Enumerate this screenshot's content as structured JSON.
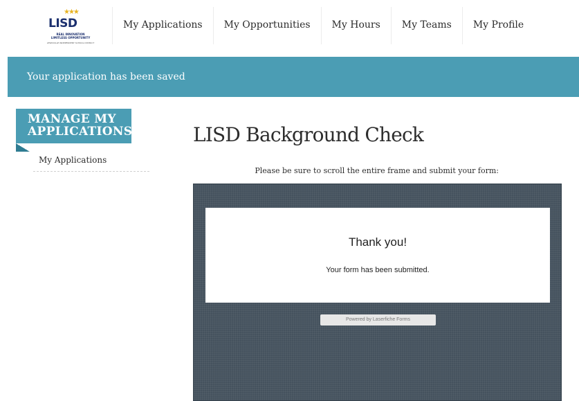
{
  "logo": {
    "name": "LISD",
    "line1": "REAL INNOVATION",
    "line2": "LIMITLESS OPPORTUNITY",
    "line3": "LEWISVILLE INDEPENDENT SCHOOL DISTRICT"
  },
  "nav": {
    "items": [
      {
        "label": "My Applications"
      },
      {
        "label": "My Opportunities"
      },
      {
        "label": "My Hours"
      },
      {
        "label": "My Teams"
      },
      {
        "label": "My Profile"
      }
    ]
  },
  "banner": {
    "message": "Your application has been saved"
  },
  "sidebar": {
    "title_line1": "MANAGE MY",
    "title_line2": "APPLICATIONS",
    "link": "My Applications"
  },
  "main": {
    "title": "LISD Background Check",
    "instruction": "Please be sure to scroll the entire frame and submit your form:",
    "form": {
      "heading": "Thank you!",
      "message": "Your form has been submitted.",
      "powered_by": "Powered by Laserfiche Forms"
    }
  },
  "colors": {
    "accent": "#4b9db4",
    "frame_bg": "#45525e"
  }
}
